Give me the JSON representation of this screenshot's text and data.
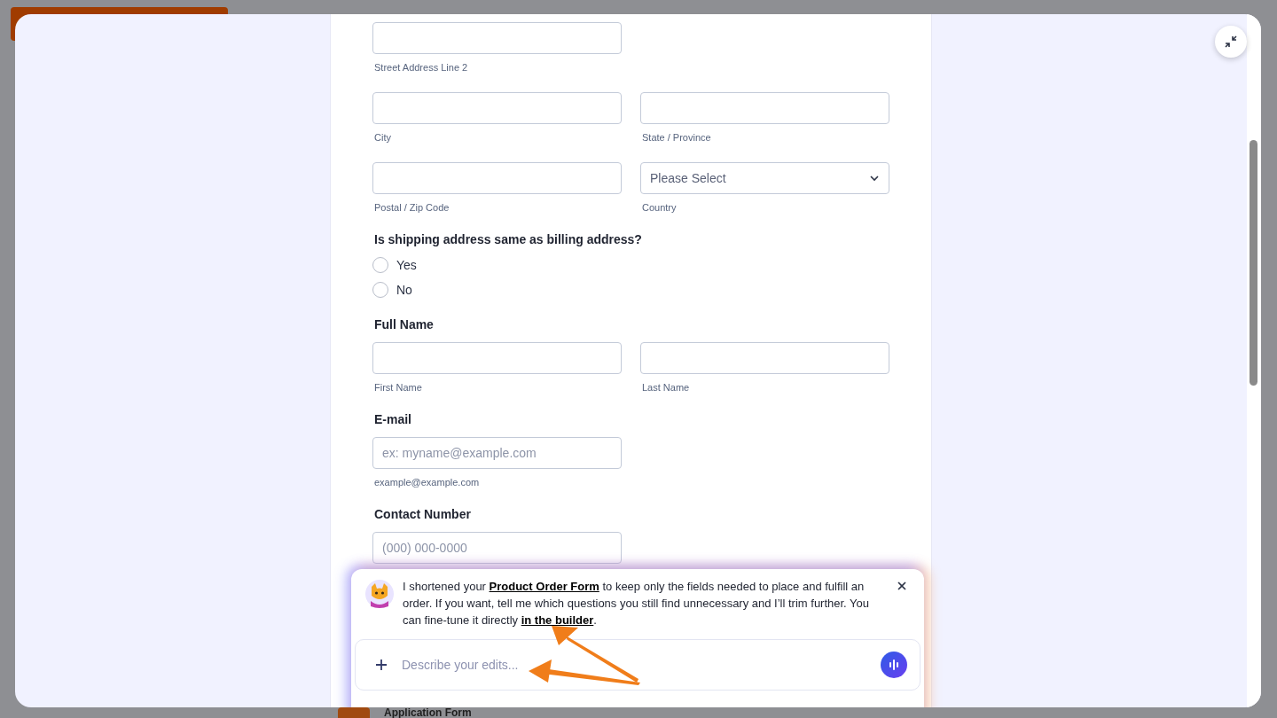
{
  "backdrop": {
    "form_title": "Application Form"
  },
  "form": {
    "sections": [
      {
        "kind": "inputs",
        "inputs": [
          {
            "kind": "text",
            "sublabel": "Street Address Line 2"
          }
        ]
      },
      {
        "kind": "inputs",
        "inputs": [
          {
            "kind": "text",
            "sublabel": "City"
          },
          {
            "kind": "text",
            "sublabel": "State / Province"
          }
        ]
      },
      {
        "kind": "inputs",
        "inputs": [
          {
            "kind": "text",
            "sublabel": "Postal / Zip Code"
          },
          {
            "kind": "select",
            "placeholder": "Please Select",
            "sublabel": "Country"
          }
        ]
      },
      {
        "kind": "radio",
        "label": "Is shipping address same as billing address?",
        "options": [
          {
            "label": "Yes",
            "selected": false
          },
          {
            "label": "No",
            "selected": false
          }
        ]
      },
      {
        "kind": "inputs",
        "label": "Full Name",
        "inputs": [
          {
            "kind": "text",
            "sublabel": "First Name"
          },
          {
            "kind": "text",
            "sublabel": "Last Name"
          }
        ]
      },
      {
        "kind": "inputs",
        "label": "E-mail",
        "inputs": [
          {
            "kind": "text",
            "placeholder": "ex: myname@example.com",
            "sublabel": "example@example.com"
          }
        ]
      },
      {
        "kind": "inputs",
        "label": "Contact Number",
        "inputs": [
          {
            "kind": "text",
            "placeholder": "(000) 000-0000"
          }
        ]
      }
    ]
  },
  "chat": {
    "message": [
      {
        "kind": "text",
        "text": "I shortened your "
      },
      {
        "kind": "link",
        "text": "Product Order Form"
      },
      {
        "kind": "text",
        "text": " to keep only the fields needed to place and fulfill an order. If you want, tell me which questions you still find unnecessary and I’ll trim further. You can fine-tune it directly "
      },
      {
        "kind": "link",
        "text": "in the builder"
      },
      {
        "kind": "text",
        "text": "."
      }
    ],
    "input": {
      "placeholder": "Describe your edits..."
    }
  }
}
